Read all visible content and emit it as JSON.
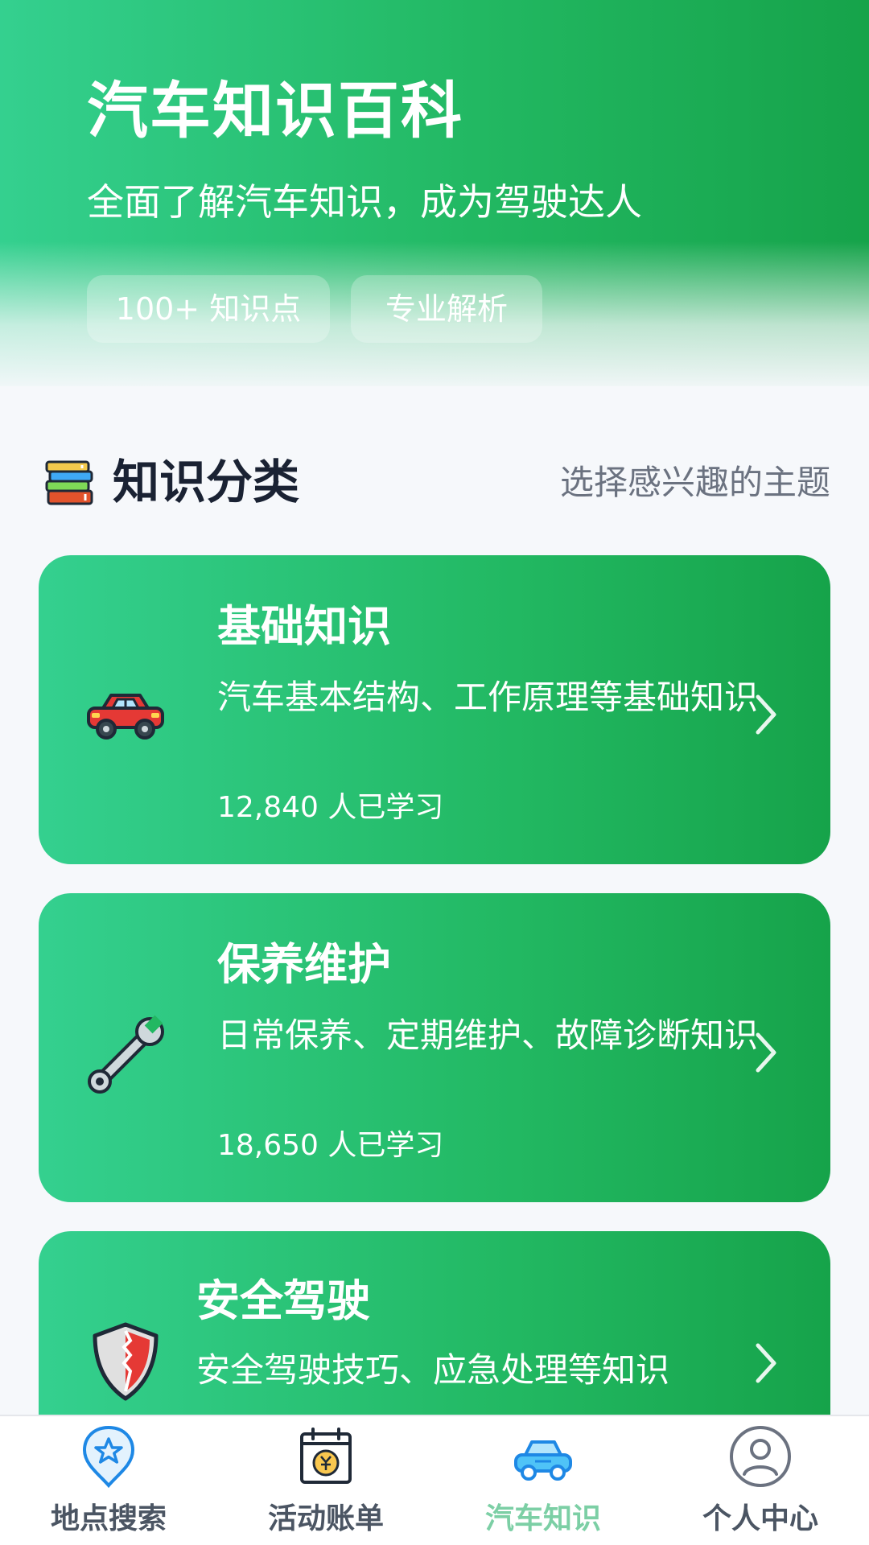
{
  "header": {
    "title": "汽车知识百科",
    "subtitle": "全面了解汽车知识，成为驾驶达人",
    "tags": [
      "100+ 知识点",
      "专业解析"
    ]
  },
  "section": {
    "icon": "books-icon",
    "title": "知识分类",
    "hint": "选择感兴趣的主题"
  },
  "categories": [
    {
      "icon": "car-icon",
      "title": "基础知识",
      "description": "汽车基本结构、工作原理等基础知识",
      "count": "12,840 人已学习"
    },
    {
      "icon": "wrench-icon",
      "title": "保养维护",
      "description": "日常保养、定期维护、故障诊断知识",
      "count": "18,650 人已学习"
    },
    {
      "icon": "shield-icon",
      "title": "安全驾驶",
      "description": "安全驾驶技巧、应急处理等知识"
    }
  ],
  "tabbar": {
    "active": 2,
    "items": [
      {
        "icon": "location-star-icon",
        "label": "地点搜索"
      },
      {
        "icon": "calendar-bill-icon",
        "label": "活动账单"
      },
      {
        "icon": "car-front-icon",
        "label": "汽车知识"
      },
      {
        "icon": "user-icon",
        "label": "个人中心"
      }
    ]
  },
  "colors": {
    "primary_start": "#34d08f",
    "primary_end": "#16a34a",
    "active_tab": "#7ccfa5"
  }
}
